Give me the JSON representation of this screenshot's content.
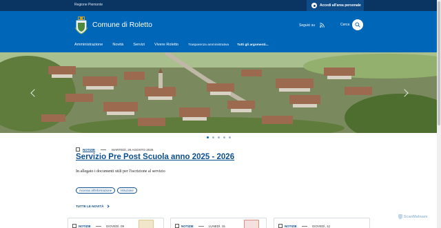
{
  "topbar": {
    "region": "Regione Piemonte",
    "login_label": "Accedi all'area personale"
  },
  "header": {
    "title": "Comune di Roletto",
    "follow_label": "Seguici su",
    "search_label": "Cerca"
  },
  "nav": {
    "items": [
      "Amministrazione",
      "Novità",
      "Servizi",
      "Vivere Roletto"
    ],
    "secondary": [
      "Trasparenza amministrativa"
    ],
    "all_topics": "Tutti gli argomenti..."
  },
  "carousel": {
    "slides": 5,
    "active": 1
  },
  "news": {
    "category": "NOTIZIE",
    "date": "MARTEDÌ, 26 AGOSTO 2025",
    "title": "Servizio Pre Post Scuola anno 2025 - 2026",
    "description": "In allegato i documenti utili per l'iscrizione al servizio",
    "tags": [
      "Accesso all'informazione",
      "Istruzione"
    ],
    "all_news_label": "TUTTE LE NOVITÀ"
  },
  "cards": [
    {
      "category": "NOTIZIE",
      "date": "GIOVEDÌ, 09"
    },
    {
      "category": "NOTIZIE",
      "date": "LUNEDÌ, 15"
    },
    {
      "category": "NOTIZIE",
      "date": "GIOVEDÌ, 12"
    }
  ],
  "watermark": "ScanMalware",
  "colors": {
    "primary": "#0066b8",
    "topbar": "#0a3462",
    "link": "#0a4e8e"
  }
}
